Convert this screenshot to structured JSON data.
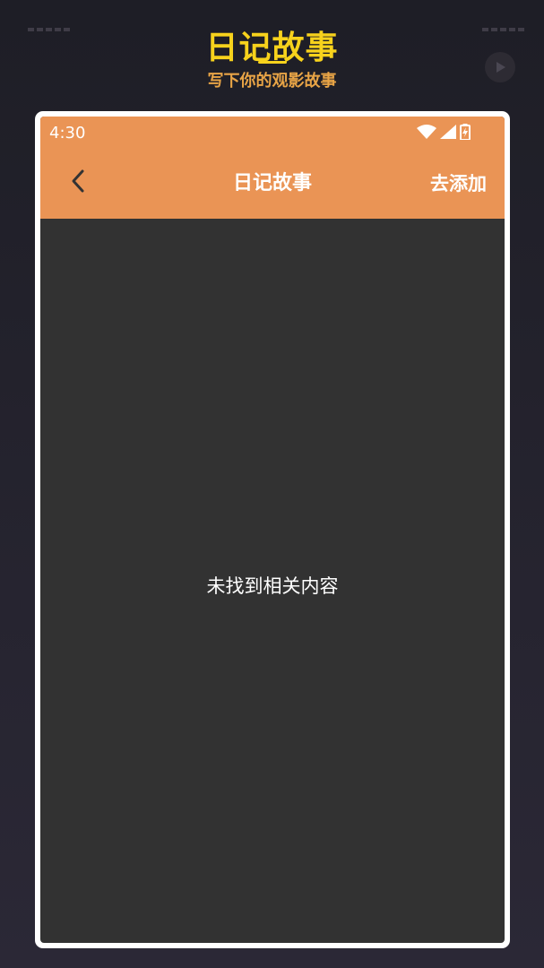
{
  "promo": {
    "title": "日记故事",
    "subtitle": "写下你的观影故事",
    "play_icon": "play-icon"
  },
  "status_bar": {
    "time": "4:30",
    "icons": [
      "wifi-icon",
      "signal-icon",
      "battery-charging-icon"
    ]
  },
  "app_bar": {
    "back_icon": "chevron-left-icon",
    "title": "日记故事",
    "action_label": "去添加"
  },
  "content": {
    "empty_message": "未找到相关内容"
  },
  "colors": {
    "accent": "#ea9455",
    "promo_title": "#f7d21c",
    "promo_subtitle": "#e8a446",
    "screen_bg": "#323232"
  }
}
